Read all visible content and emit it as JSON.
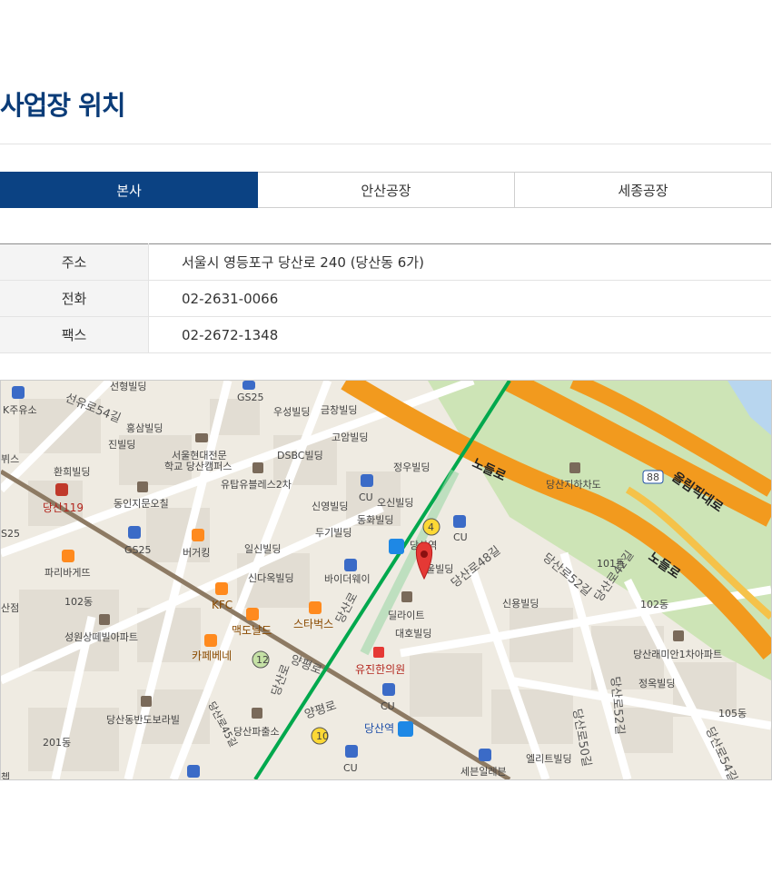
{
  "page": {
    "title": "사업장 위치"
  },
  "tabs": [
    {
      "label": "본사",
      "active": true
    },
    {
      "label": "안산공장",
      "active": false
    },
    {
      "label": "세종공장",
      "active": false
    }
  ],
  "info": {
    "address_label": "주소",
    "address_value": "서울시 영등포구 당산로 240 (당산동 6가)",
    "phone_label": "전화",
    "phone_value": "02-2631-0066",
    "fax_label": "팩스",
    "fax_value": "02-2672-1348"
  },
  "map": {
    "colors": {
      "highway": "#f29a1e",
      "river_park": "#cbe3b3",
      "subway_line2": "#00a84d",
      "rail": "#8d7a63",
      "marker": "#e53935"
    },
    "labels": {
      "seonhyeong": "선형빌딩",
      "gs25_a": "GS25",
      "gs25_b": "GS25",
      "gs25_c": "GS25",
      "woosung": "우성빌딩",
      "geumchang": "금창빌딩",
      "goam": "고암빌딩",
      "seonyuro54": "선유로54길",
      "hongsam": "홍삼빌딩",
      "jinbil": "진빌딩",
      "k_oil": "K주유소",
      "hwanhee": "환희빌딩",
      "dangsan119": "당산119",
      "dongin": "동인지문오칠",
      "school1": "서울현대전문",
      "school2": "학교 당산캠퍼스",
      "utop": "유탑유블레스2차",
      "dsbc": "DSBC빌딩",
      "jungwoo": "정우빌딩",
      "cu_a": "CU",
      "cu_b": "CU",
      "cu_c": "CU",
      "cu_d": "CU",
      "shinyoung": "신영빌딩",
      "osin": "오신빌딩",
      "doogi": "두기빌딩",
      "donghwa": "동화빌딩",
      "station4": "4",
      "dangsan_station_top": "당산역",
      "parisbaguette": "파리바게뜨",
      "burgerking": "버거킹",
      "ilshin": "일신빌딩",
      "sindaok": "신다옥빌딩",
      "biwi": "바이더웨이",
      "dong102_a": "102동",
      "kfc": "KFC",
      "mcd": "맥도날드",
      "starbucks": "스타벅스",
      "sungwon": "성원상떼빌아파트",
      "cafebene": "카페베네",
      "num12": "12",
      "yangpyeong_a": "양평로",
      "yangpyeong_b": "양평로",
      "dangsanro_a": "당산로",
      "dangsanro_b": "당산로",
      "dangsanro45": "당산로45길",
      "bando": "당산동반도보라빌",
      "dangsan_pa": "당산파출소",
      "num10": "10",
      "dong201": "201동",
      "dangsan_station_bot": "당산역",
      "yujin": "유진한의원",
      "delight": "딜라이트",
      "daeho": "대호빌딩",
      "jeolbil": "울빌딩",
      "dangsanro48": "당산로48길",
      "sinyong": "신용빌딩",
      "dangsanro52_a": "당산로52길",
      "dangsanro52_b": "당산로52길",
      "dangsanro50": "당산로50길",
      "dangsanro54": "당산로54길",
      "dangsanro42": "당산로42길",
      "jeongok": "정옥빌딩",
      "raemian": "당산래미안1차아파트",
      "dong101": "101동",
      "dong102_b": "102동",
      "dong105": "105동",
      "underpass": "당산지하차도",
      "olympic": "올림픽대로",
      "nodeul_a": "노들로",
      "nodeul_b": "노들로",
      "route88": "88",
      "elliet": "엘리트빌딩",
      "seven": "세븐일레븐",
      "sanjeom": "산점",
      "cheop": "쳅",
      "gs25_edge": "S25",
      "ggisu": "뷔스"
    }
  }
}
